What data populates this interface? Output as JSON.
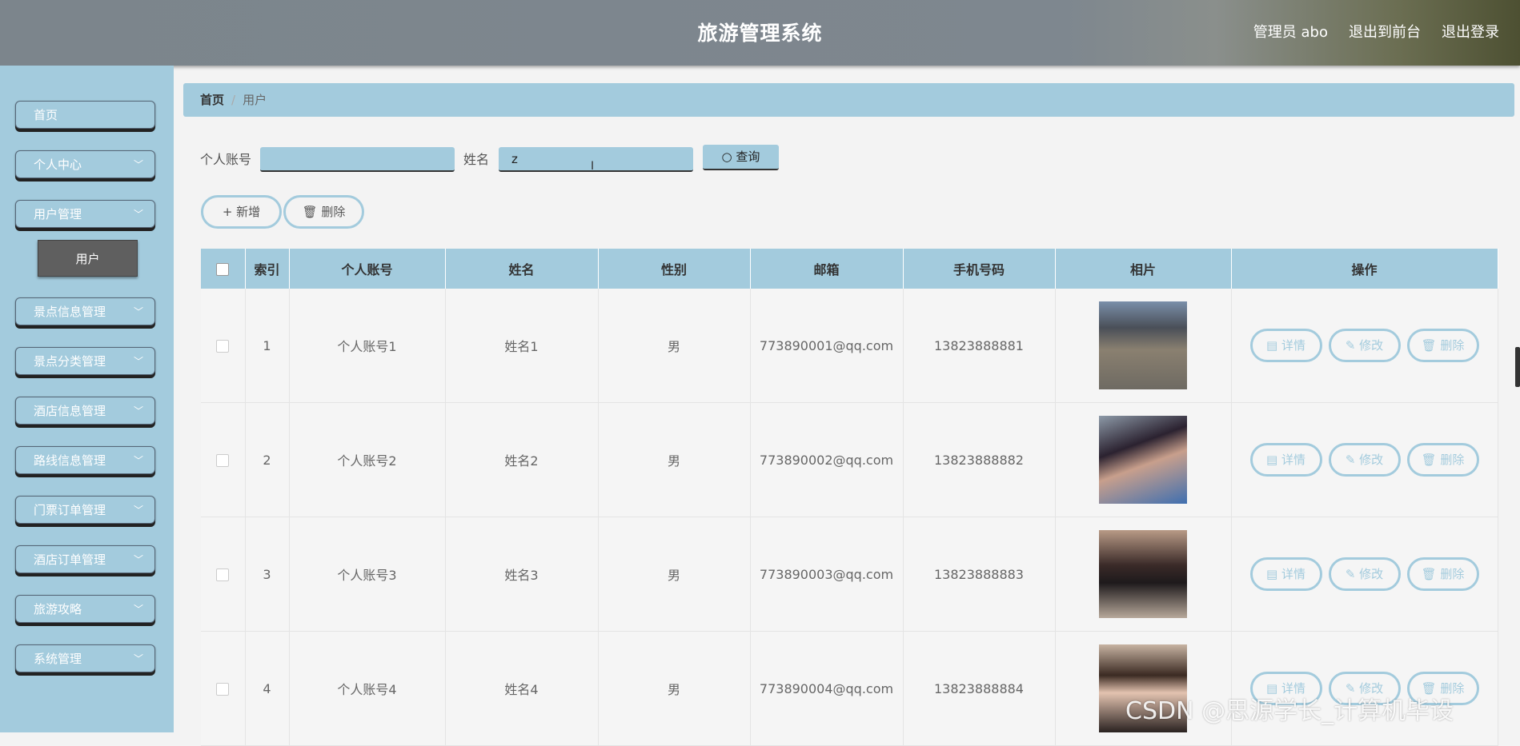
{
  "header": {
    "title": "旅游管理系统",
    "admin": "管理员 abo",
    "exit_front": "退出到前台",
    "logout": "退出登录"
  },
  "sidebar": {
    "items": [
      {
        "label": "首页",
        "expandable": false
      },
      {
        "label": "个人中心",
        "expandable": true
      },
      {
        "label": "用户管理",
        "expandable": true
      },
      {
        "label": "景点信息管理",
        "expandable": true
      },
      {
        "label": "景点分类管理",
        "expandable": true
      },
      {
        "label": "酒店信息管理",
        "expandable": true
      },
      {
        "label": "路线信息管理",
        "expandable": true
      },
      {
        "label": "门票订单管理",
        "expandable": true
      },
      {
        "label": "酒店订单管理",
        "expandable": true
      },
      {
        "label": "旅游攻略",
        "expandable": true
      },
      {
        "label": "系统管理",
        "expandable": true
      }
    ],
    "submenu": {
      "label": "用户",
      "active": true
    }
  },
  "breadcrumb": {
    "home": "首页",
    "sep": "/",
    "current": "用户"
  },
  "search": {
    "account_label": "个人账号",
    "account_value": "",
    "name_label": "姓名",
    "name_value": "z",
    "query_label": "查询"
  },
  "actions": {
    "add": "新增",
    "delete": "删除"
  },
  "table": {
    "headers": [
      "",
      "索引",
      "个人账号",
      "姓名",
      "性别",
      "邮箱",
      "手机号码",
      "相片",
      "操作"
    ],
    "rows": [
      {
        "index": "1",
        "account": "个人账号1",
        "name": "姓名1",
        "gender": "男",
        "email": "773890001@qq.com",
        "phone": "13823888881"
      },
      {
        "index": "2",
        "account": "个人账号2",
        "name": "姓名2",
        "gender": "男",
        "email": "773890002@qq.com",
        "phone": "13823888882"
      },
      {
        "index": "3",
        "account": "个人账号3",
        "name": "姓名3",
        "gender": "男",
        "email": "773890003@qq.com",
        "phone": "13823888883"
      },
      {
        "index": "4",
        "account": "个人账号4",
        "name": "姓名4",
        "gender": "男",
        "email": "773890004@qq.com",
        "phone": "13823888884"
      }
    ],
    "row_actions": {
      "detail": "详情",
      "edit": "修改",
      "delete": "删除"
    }
  },
  "watermark": "CSDN @思源学长_计算机毕设",
  "colors": {
    "accent": "#a3cbdd",
    "header": "#7c858c",
    "submenu_active": "#5f5f5f"
  }
}
